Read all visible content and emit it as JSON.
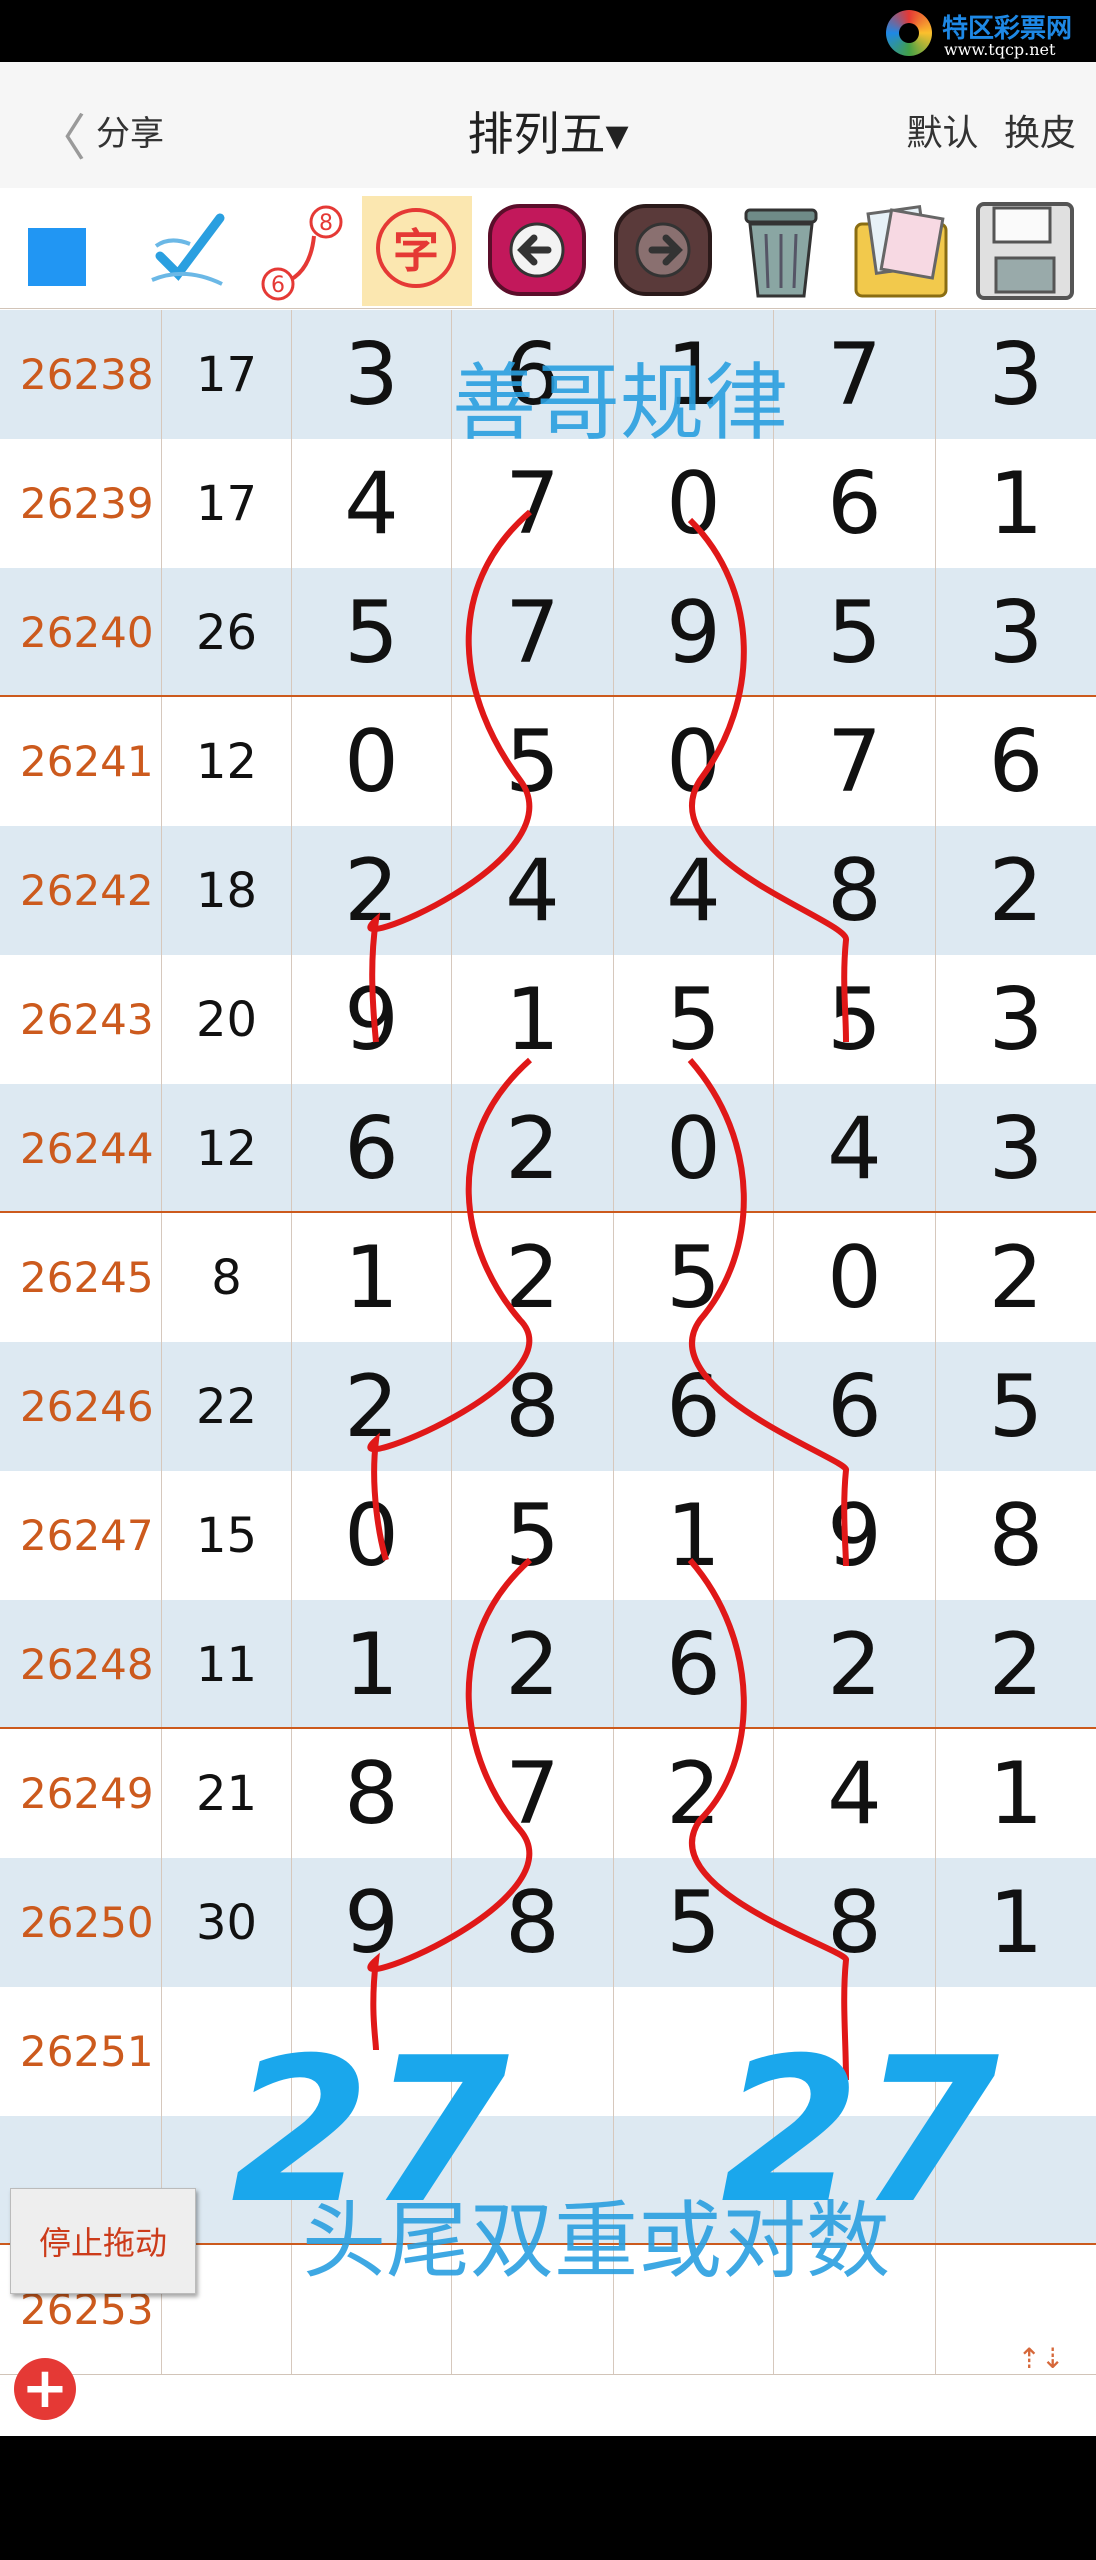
{
  "watermark": {
    "name": "特区彩票网",
    "url": "www.tqcp.net"
  },
  "header": {
    "back": "〈",
    "share": "分享",
    "title": "排列五▾",
    "default_btn": "默认",
    "skin_btn": "换皮"
  },
  "toolbar": {
    "char_label": "字",
    "num_top": "8",
    "num_bottom": "6"
  },
  "rows": [
    {
      "id": "26238",
      "sum": "17",
      "d": [
        "3",
        "6",
        "1",
        "7",
        "3"
      ]
    },
    {
      "id": "26239",
      "sum": "17",
      "d": [
        "4",
        "7",
        "0",
        "6",
        "1"
      ]
    },
    {
      "id": "26240",
      "sum": "26",
      "d": [
        "5",
        "7",
        "9",
        "5",
        "3"
      ]
    },
    {
      "id": "26241",
      "sum": "12",
      "d": [
        "0",
        "5",
        "0",
        "7",
        "6"
      ]
    },
    {
      "id": "26242",
      "sum": "18",
      "d": [
        "2",
        "4",
        "4",
        "8",
        "2"
      ]
    },
    {
      "id": "26243",
      "sum": "20",
      "d": [
        "9",
        "1",
        "5",
        "5",
        "3"
      ]
    },
    {
      "id": "26244",
      "sum": "12",
      "d": [
        "6",
        "2",
        "0",
        "4",
        "3"
      ]
    },
    {
      "id": "26245",
      "sum": "8",
      "d": [
        "1",
        "2",
        "5",
        "0",
        "2"
      ]
    },
    {
      "id": "26246",
      "sum": "22",
      "d": [
        "2",
        "8",
        "6",
        "6",
        "5"
      ]
    },
    {
      "id": "26247",
      "sum": "15",
      "d": [
        "0",
        "5",
        "1",
        "9",
        "8"
      ]
    },
    {
      "id": "26248",
      "sum": "11",
      "d": [
        "1",
        "2",
        "6",
        "2",
        "2"
      ]
    },
    {
      "id": "26249",
      "sum": "21",
      "d": [
        "8",
        "7",
        "2",
        "4",
        "1"
      ]
    },
    {
      "id": "26250",
      "sum": "30",
      "d": [
        "9",
        "8",
        "5",
        "8",
        "1"
      ]
    },
    {
      "id": "26251",
      "sum": "",
      "d": [
        "",
        "",
        "",
        "",
        ""
      ]
    },
    {
      "id": "",
      "sum": "",
      "d": [
        "",
        "",
        "",
        "",
        ""
      ]
    },
    {
      "id": "26253",
      "sum": "",
      "d": [
        "",
        "",
        "",
        "",
        ""
      ]
    }
  ],
  "annotations": {
    "top_text": "善哥规律",
    "bottom_text": "头尾双重或对数",
    "left_number": "27",
    "right_number": "27"
  },
  "buttons": {
    "stop_drag": "停止拖动",
    "add": "+",
    "scroll_hint": "⇡⇣"
  },
  "colors": {
    "accent_orange": "#cc5a1d",
    "row_alt": "#dde9f2",
    "annotation_blue": "#2a9fe0",
    "stroke_red": "#e01818"
  }
}
